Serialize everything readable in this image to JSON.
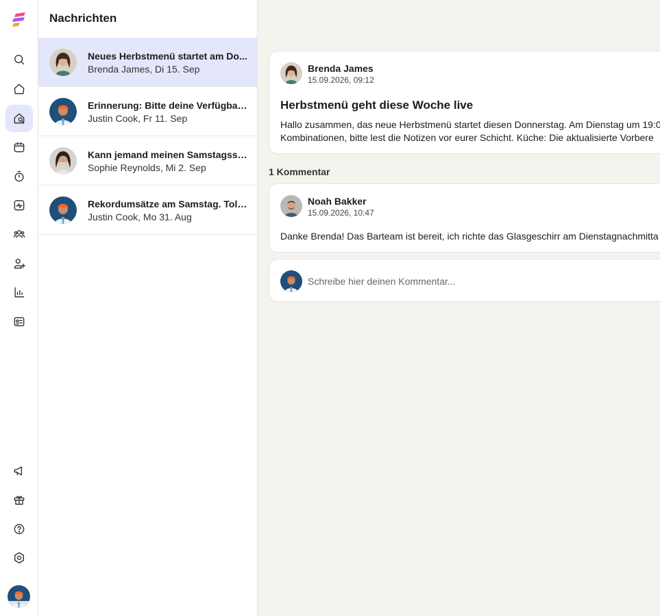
{
  "app": {
    "brand_colors": [
      "#ef4f7c",
      "#8b5cf6",
      "#f5a524"
    ],
    "accent": "#e4e6fb"
  },
  "rail": {
    "icons": [
      {
        "name": "search-icon"
      },
      {
        "name": "home-icon"
      },
      {
        "name": "messages-icon",
        "active": true
      },
      {
        "name": "calendar-icon"
      },
      {
        "name": "timer-icon"
      },
      {
        "name": "activity-icon"
      },
      {
        "name": "team-icon"
      },
      {
        "name": "add-user-icon"
      },
      {
        "name": "reports-icon"
      },
      {
        "name": "id-card-icon"
      },
      {
        "name": "megaphone-icon"
      },
      {
        "name": "gift-icon"
      },
      {
        "name": "help-icon"
      },
      {
        "name": "settings-icon"
      }
    ]
  },
  "list": {
    "title": "Nachrichten",
    "items": [
      {
        "subject": "Neues Herbstmenü startet am Do...",
        "meta": "Brenda James, Di 15. Sep",
        "avatar": "brenda"
      },
      {
        "subject": "Erinnerung: Bitte deine Verfügbar...",
        "meta": "Justin Cook, Fr 11. Sep",
        "avatar": "justin"
      },
      {
        "subject": "Kann jemand meinen Samstagssc...",
        "meta": "Sophie Reynolds, Mi 2. Sep",
        "avatar": "sophie"
      },
      {
        "subject": "Rekordumsätze am Samstag. Tolle...",
        "meta": "Justin Cook, Mo 31. Aug",
        "avatar": "justin"
      }
    ]
  },
  "post": {
    "author": "Brenda James",
    "date": "15.09.2026, 09:12",
    "title": "Herbstmenü geht diese Woche live",
    "body_line1": "Hallo zusammen, das neue Herbstmenü startet diesen Donnerstag. Am Dienstag um 19:0",
    "body_line2": "Kombinationen, bitte lest die Notizen vor eurer Schicht. Küche: Die aktualisierte Vorbere"
  },
  "comments": {
    "count_label": "1 Kommentar",
    "items": [
      {
        "author": "Noah Bakker",
        "date": "15.09.2026, 10:47",
        "body": "Danke Brenda! Das Barteam ist bereit, ich richte das Glasgeschirr am Dienstagnachmitta"
      }
    ],
    "input_placeholder": "Schreibe hier deinen Kommentar..."
  }
}
